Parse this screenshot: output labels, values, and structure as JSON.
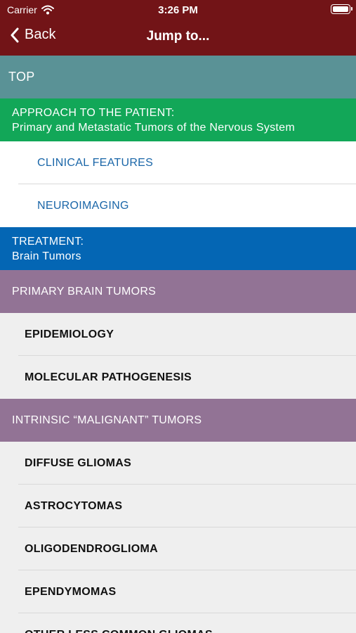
{
  "status_bar": {
    "carrier": "Carrier",
    "time": "3:26 PM"
  },
  "nav": {
    "back_label": "Back",
    "title": "Jump to..."
  },
  "items": {
    "top": "TOP",
    "approach_line1": "APPROACH TO THE PATIENT:",
    "approach_line2": "Primary and Metastatic Tumors of the Nervous System",
    "clinical_features": "CLINICAL FEATURES",
    "neuroimaging": "NEUROIMAGING",
    "treatment_line1": "TREATMENT:",
    "treatment_line2": "Brain Tumors",
    "primary_brain_tumors": "PRIMARY BRAIN TUMORS",
    "epidemiology": "EPIDEMIOLOGY",
    "molecular_pathogenesis": "MOLECULAR PATHOGENESIS",
    "intrinsic_malignant": "INTRINSIC “MALIGNANT” TUMORS",
    "diffuse_gliomas": "DIFFUSE GLIOMAS",
    "astrocytomas": "ASTROCYTOMAS",
    "oligodendroglioma": "OLIGODENDROGLIOMA",
    "ependymomas": "EPENDYMOMAS",
    "other_less_common": "OTHER LESS COMMON GLIOMAS"
  },
  "colors": {
    "header": "#721417",
    "top": "#5a9296",
    "approach": "#12a758",
    "treatment": "#0466b4",
    "section": "#927395",
    "link": "#1a66a8"
  }
}
